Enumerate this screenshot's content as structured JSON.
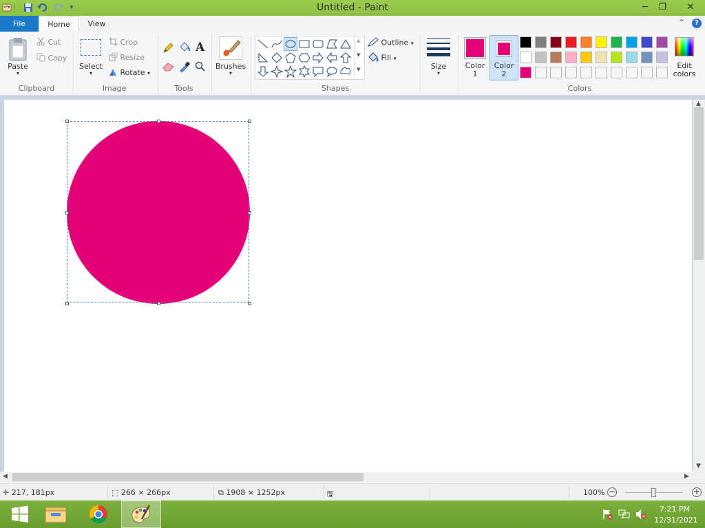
{
  "window": {
    "title": "Untitled - Paint",
    "controls": [
      "minimize",
      "restore",
      "close"
    ]
  },
  "quick_access": [
    "paint-menu-icon",
    "save-icon",
    "undo-icon",
    "redo-icon",
    "customize-icon"
  ],
  "tabs": {
    "file": "File",
    "home": "Home",
    "view": "View"
  },
  "ribbon": {
    "clipboard": {
      "label": "Clipboard",
      "paste": "Paste",
      "cut": "Cut",
      "copy": "Copy"
    },
    "image": {
      "label": "Image",
      "select": "Select",
      "crop": "Crop",
      "resize": "Resize",
      "rotate": "Rotate"
    },
    "tools": {
      "label": "Tools"
    },
    "brushes": {
      "label": "Brushes"
    },
    "shapes": {
      "label": "Shapes",
      "outline": "Outline",
      "fill": "Fill"
    },
    "size": {
      "label": "Size"
    },
    "colors": {
      "label": "Colors",
      "color1_label": "Color",
      "color1_num": "1",
      "color2_label": "Color",
      "color2_num": "2",
      "color1_value": "#e5007a",
      "color2_value": "#e5007a",
      "edit_label": "Edit",
      "edit_label2": "colors",
      "palette_row1": [
        "#000000",
        "#7f7f7f",
        "#880015",
        "#ed1c24",
        "#ff7f27",
        "#fff200",
        "#22b14c",
        "#00a2e8",
        "#3f48cc",
        "#a349a4"
      ],
      "palette_row2": [
        "#ffffff",
        "#c3c3c3",
        "#b97a57",
        "#ffaec9",
        "#ffc90e",
        "#efe4b0",
        "#b5e61d",
        "#99d9ea",
        "#7092be",
        "#c8bfe7"
      ],
      "palette_row3": [
        "#e5007a",
        "#f5f5f5",
        "#f5f5f5",
        "#f5f5f5",
        "#f5f5f5",
        "#f5f5f5",
        "#f5f5f5",
        "#f5f5f5",
        "#f5f5f5",
        "#f5f5f5"
      ]
    }
  },
  "canvas": {
    "shape": "ellipse",
    "fill_color": "#e5007a"
  },
  "status": {
    "cursor": "217, 181px",
    "selection": "266 × 266px",
    "image_size": "1908 × 1252px",
    "zoom": "100%"
  },
  "taskbar": {
    "apps": [
      "start-button",
      "file-explorer",
      "chrome",
      "paint"
    ],
    "time": "7:21 PM",
    "date": "12/31/2021"
  }
}
